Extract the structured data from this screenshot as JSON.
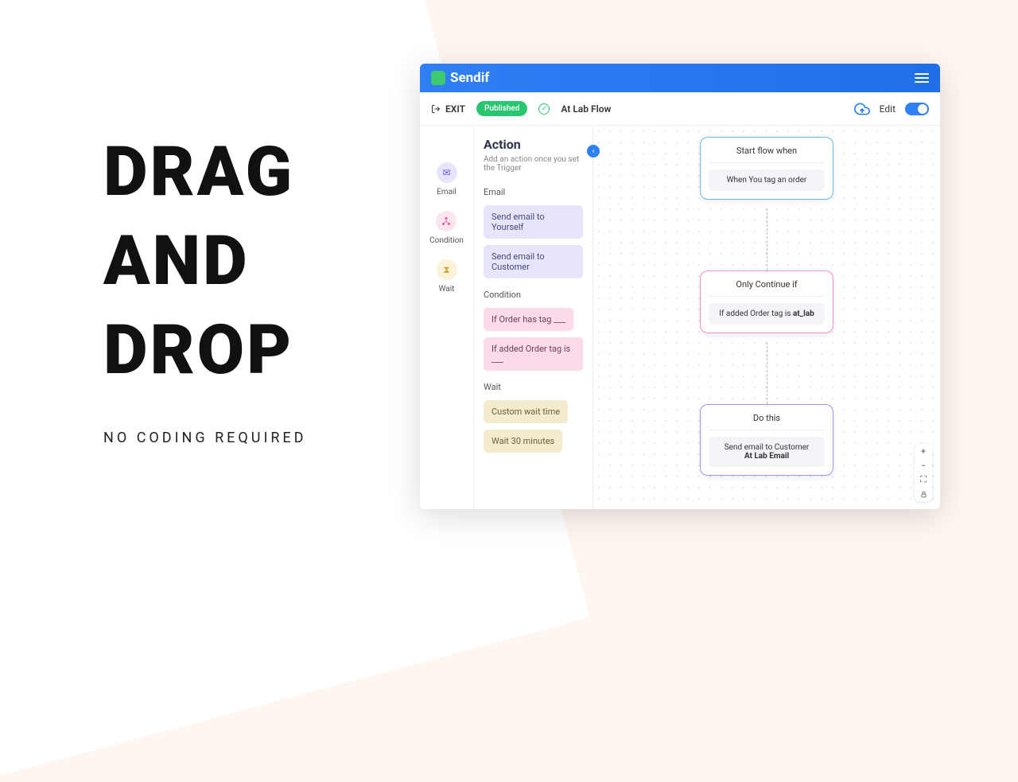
{
  "hero": {
    "line1": "DRAG",
    "line2": "AND",
    "line3": "DROP",
    "subtitle": "NO CODING REQUIRED"
  },
  "app": {
    "brand": "Sendif",
    "toolbar": {
      "exit": "EXIT",
      "published": "Published",
      "flow_name": "At Lab Flow",
      "edit": "Edit"
    },
    "panel": {
      "title": "Action",
      "subtitle": "Add an action once you set the Trigger",
      "icons": {
        "email": "Email",
        "condition": "Condition",
        "wait": "Wait"
      },
      "sections": {
        "email": {
          "label": "Email",
          "items": [
            "Send email to Yourself",
            "Send email to Customer"
          ]
        },
        "condition": {
          "label": "Condition",
          "items": [
            "If Order has tag ___",
            "If added Order tag is ___"
          ]
        },
        "wait": {
          "label": "Wait",
          "items": [
            "Custom wait time",
            "Wait 30 minutes"
          ]
        }
      }
    },
    "nodes": {
      "start": {
        "header": "Start flow when",
        "body": "When You tag an order"
      },
      "condition": {
        "header": "Only Continue if",
        "body_prefix": "If added Order tag is ",
        "body_bold": "at_lab"
      },
      "do": {
        "header": "Do this",
        "body_line1": "Send email to Customer",
        "body_line2": "At Lab Email"
      }
    }
  }
}
